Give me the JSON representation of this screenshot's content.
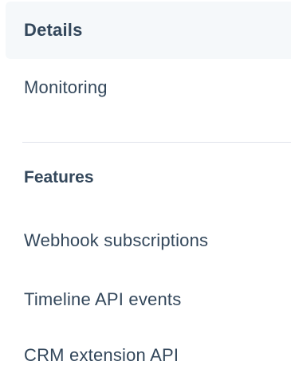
{
  "nav": {
    "items": [
      {
        "label": "Details",
        "active": true
      },
      {
        "label": "Monitoring",
        "active": false
      }
    ],
    "features": {
      "heading": "Features",
      "items": [
        {
          "label": "Webhook subscriptions"
        },
        {
          "label": "Timeline API events"
        },
        {
          "label": "CRM extension API"
        }
      ]
    }
  },
  "colors": {
    "text": "#33475b",
    "active_background": "#f5f8fa",
    "divider": "#dfe3eb"
  }
}
